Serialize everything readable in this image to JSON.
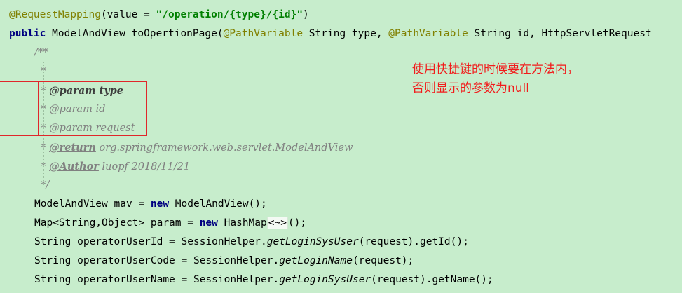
{
  "editor": {
    "lines": [
      {
        "name": "line-request-mapping",
        "parts": [
          {
            "t": "@RequestMapping",
            "c": "ann"
          },
          {
            "t": "(value = "
          },
          {
            "t": "\"/operation/{type}/{id}\"",
            "c": "str"
          },
          {
            "t": ")"
          }
        ]
      },
      {
        "name": "line-method-signature",
        "parts": [
          {
            "t": "public",
            "c": "kw"
          },
          {
            "t": " ModelAndView toOpertionPage("
          },
          {
            "t": "@PathVariable",
            "c": "ann"
          },
          {
            "t": " String type, "
          },
          {
            "t": "@PathVariable",
            "c": "ann"
          },
          {
            "t": " String id, HttpServletRequest"
          }
        ]
      },
      {
        "name": "line-doc-open",
        "indent": 1,
        "parts": [
          {
            "t": "/**",
            "c": "doc"
          }
        ]
      },
      {
        "name": "line-doc-blank",
        "indent": 1,
        "parts": [
          {
            "t": "  *",
            "c": "doc"
          }
        ]
      },
      {
        "name": "line-doc-param-type",
        "indent": 1,
        "parts": [
          {
            "t": "  * ",
            "c": "doc"
          },
          {
            "t": "@param",
            "c": "docparam"
          },
          {
            "t": " type",
            "c": "docparam"
          }
        ]
      },
      {
        "name": "line-doc-param-id",
        "indent": 1,
        "parts": [
          {
            "t": "  * @param id",
            "c": "doc"
          }
        ]
      },
      {
        "name": "line-doc-param-request",
        "indent": 1,
        "parts": [
          {
            "t": "  * @param request",
            "c": "doc"
          }
        ]
      },
      {
        "name": "line-doc-return",
        "indent": 1,
        "parts": [
          {
            "t": "  * ",
            "c": "doc"
          },
          {
            "t": "@return",
            "c": "doctag"
          },
          {
            "t": " org.springframework.web.servlet.ModelAndView",
            "c": "doc"
          }
        ]
      },
      {
        "name": "line-doc-author",
        "indent": 1,
        "parts": [
          {
            "t": "  * ",
            "c": "doc"
          },
          {
            "t": "@Author",
            "c": "doctag"
          },
          {
            "t": " luopf 2018/11/21",
            "c": "doc"
          }
        ]
      },
      {
        "name": "line-doc-close",
        "indent": 1,
        "parts": [
          {
            "t": "  */",
            "c": "doc"
          }
        ]
      },
      {
        "name": "line-new-mav",
        "indent": 1,
        "parts": [
          {
            "t": "ModelAndView mav = "
          },
          {
            "t": "new",
            "c": "kw"
          },
          {
            "t": " ModelAndView();"
          }
        ]
      },
      {
        "name": "line-new-map",
        "indent": 1,
        "parts": [
          {
            "t": "Map<String,Object> param = "
          },
          {
            "t": "new",
            "c": "kw"
          },
          {
            "t": " HashMap"
          },
          {
            "t": "<~>",
            "c": "hint"
          },
          {
            "t": "();"
          }
        ]
      },
      {
        "name": "line-operator-user-id",
        "indent": 1,
        "parts": [
          {
            "t": "String operatorUserId = SessionHelper."
          },
          {
            "t": "getLoginSysUser",
            "c": "call"
          },
          {
            "t": "(request).getId();"
          }
        ]
      },
      {
        "name": "line-operator-user-code",
        "indent": 1,
        "parts": [
          {
            "t": "String operatorUserCode = SessionHelper."
          },
          {
            "t": "getLoginName",
            "c": "call"
          },
          {
            "t": "(request);"
          }
        ]
      },
      {
        "name": "line-operator-user-name",
        "indent": 1,
        "parts": [
          {
            "t": "String operatorUserName = SessionHelper."
          },
          {
            "t": "getLoginSysUser",
            "c": "call"
          },
          {
            "t": "(request).getName();"
          }
        ]
      }
    ]
  },
  "note": {
    "line1": "使用快捷键的时候要在方法内，",
    "line2": "否则显示的参数为null"
  },
  "colors": {
    "background": "#c7edcc",
    "annotation": "#808000",
    "keyword": "#000080",
    "string": "#008000",
    "comment": "#808080",
    "highlight": "#e0262a",
    "note": "#f21b1b"
  }
}
